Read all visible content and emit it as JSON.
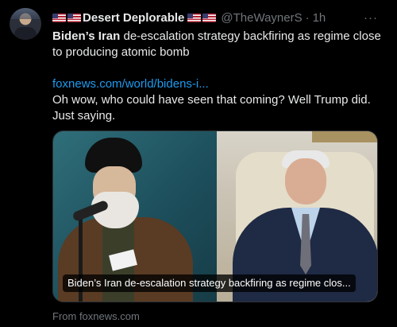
{
  "author": {
    "flags_prefix": "🇺🇸🇺🇸",
    "name": "Desert Deplorable",
    "flags_suffix": "🇺🇸🇺🇸",
    "handle": "@TheWaynerS",
    "separator": "·",
    "time": "1h"
  },
  "more_label": "···",
  "post": {
    "headline_bold": "Biden’s Iran",
    "headline_rest": " de-escalation strategy backfiring as regime close to producing atomic bomb",
    "link": "foxnews.com/world/bidens-i...",
    "comment": "Oh wow, who could have seen that coming? Well Trump did. Just saying."
  },
  "card": {
    "caption": "Biden’s Iran de-escalation strategy backfiring as regime clos...",
    "source": "From foxnews.com"
  },
  "colors": {
    "background": "#000000",
    "text": "#e7e9ea",
    "muted": "#71767b",
    "link": "#1d9bf0"
  }
}
